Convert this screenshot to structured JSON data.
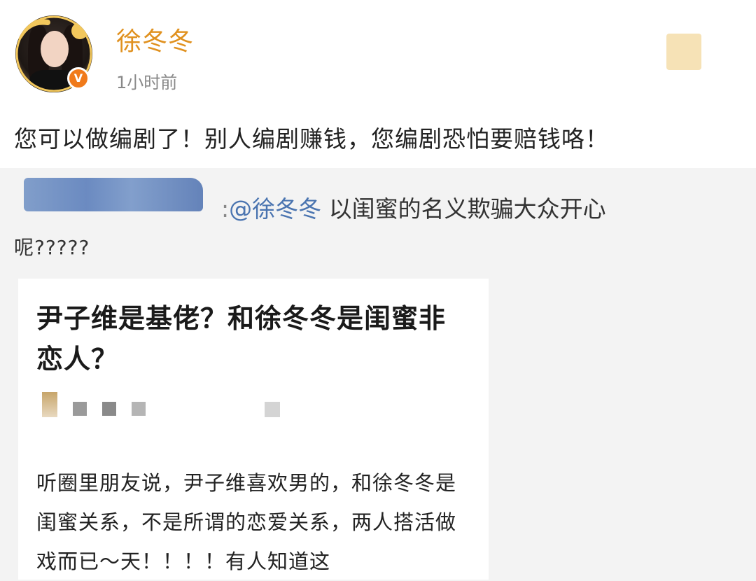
{
  "post": {
    "username": "徐冬冬",
    "timestamp": "1小时前",
    "verified_badge": "V",
    "text": "您可以做编剧了！别人编剧赚钱，您编剧恐怕要赔钱咯！",
    "colors": {
      "username": "#e0911f",
      "verified": "#f07a1a"
    }
  },
  "repost": {
    "separator": ":",
    "mention": "@徐冬冬",
    "text_line1": " 以闺蜜的名义欺骗大众开心",
    "text_line2": "呢?????",
    "colors": {
      "mention": "#4a74b0"
    }
  },
  "article_card": {
    "title": "尹子维是基佬？和徐冬冬是闺蜜非恋人？",
    "body": "听圈里朋友说，尹子维喜欢男的，和徐冬冬是闺蜜关系，不是所谓的恋爱关系，两人搭活做戏而已～天！！！！有人知道这"
  }
}
